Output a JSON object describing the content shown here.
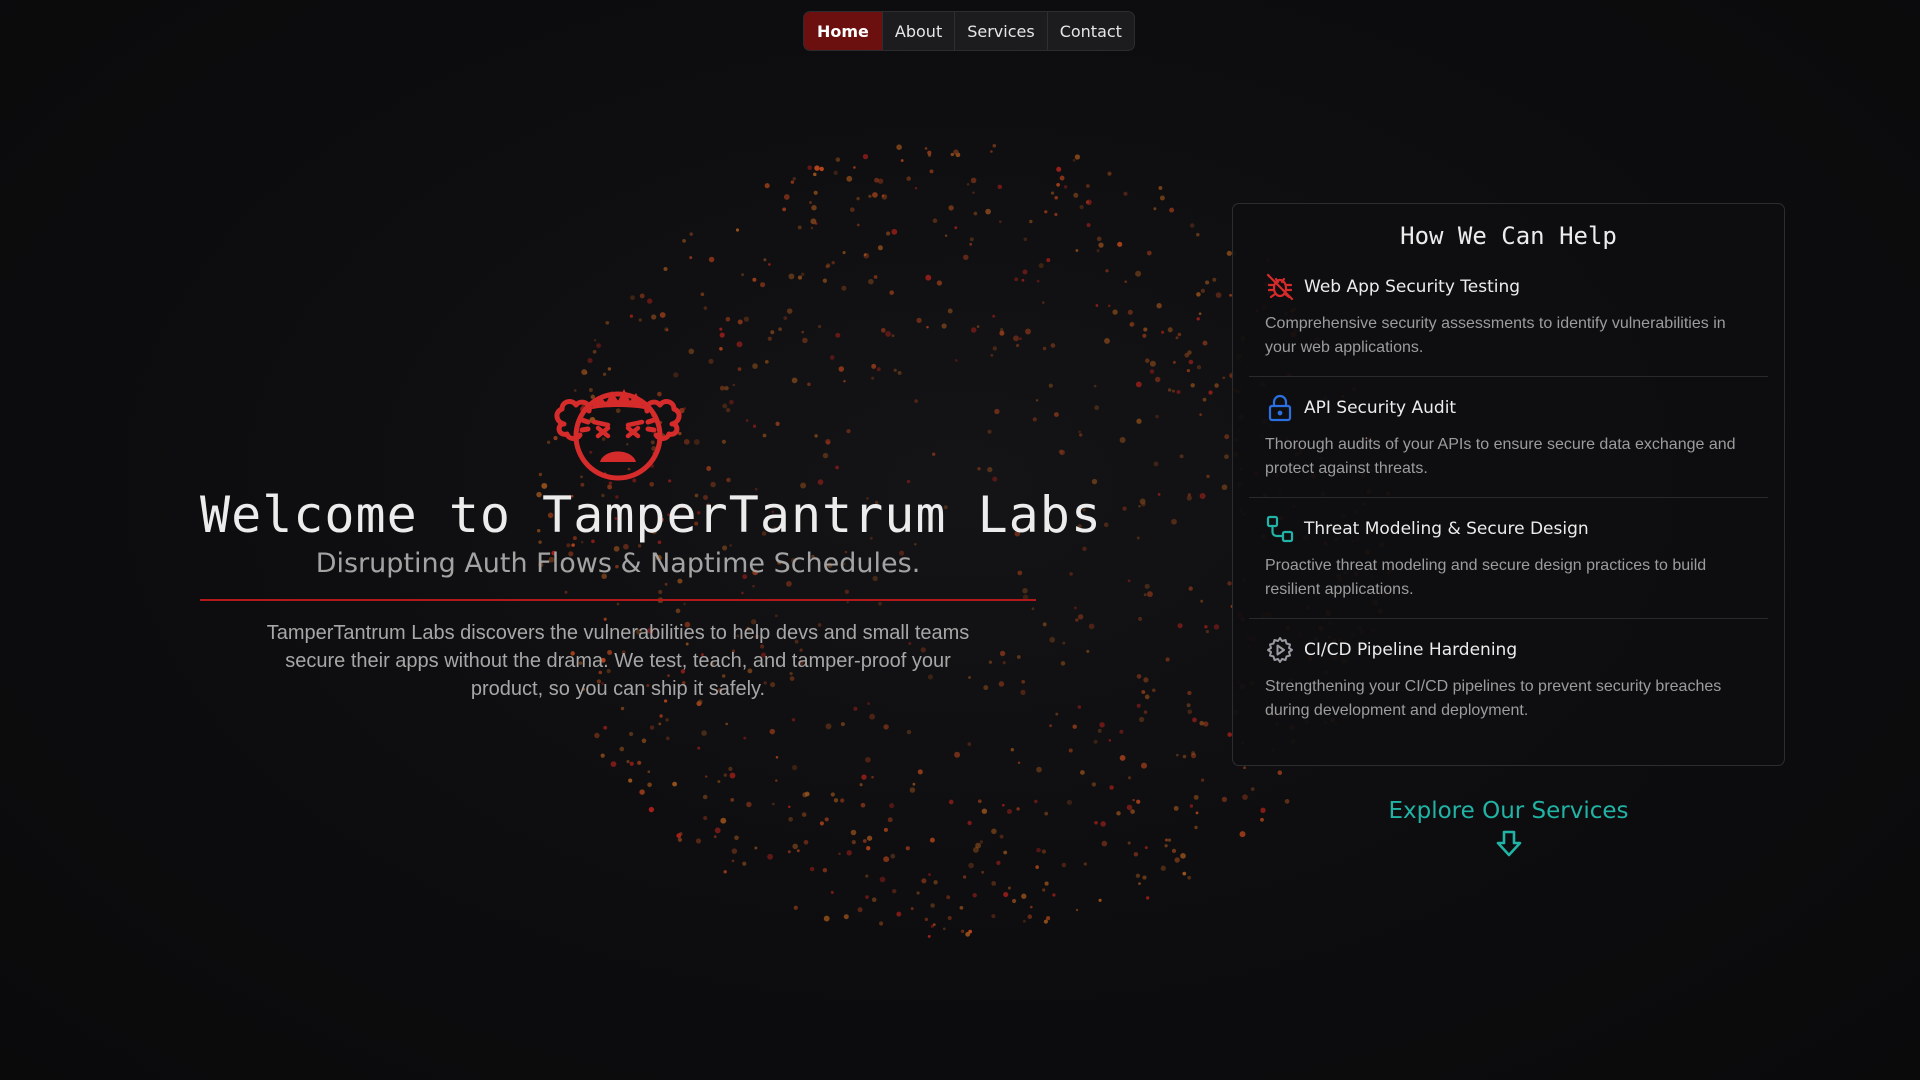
{
  "nav": {
    "items": [
      {
        "label": "Home",
        "active": true
      },
      {
        "label": "About",
        "active": false
      },
      {
        "label": "Services",
        "active": false
      },
      {
        "label": "Contact",
        "active": false
      }
    ]
  },
  "hero": {
    "icon": "angry-face-icon",
    "title": "Welcome to TamperTantrum Labs",
    "subtitle": "Disrupting Auth Flows & Naptime Schedules.",
    "description": "TamperTantrum Labs discovers the vulnerabilities to help devs and small teams secure their apps without the drama. We test, teach, and tamper-proof your product, so you can ship it safely."
  },
  "services_card": {
    "title": "How We Can Help",
    "items": [
      {
        "icon": "bug-off-icon",
        "icon_color": "#d62b2b",
        "name": "Web App Security Testing",
        "description": "Comprehensive security assessments to identify vulnerabilities in your web applications."
      },
      {
        "icon": "lock-icon",
        "icon_color": "#2b6fe0",
        "name": "API Security Audit",
        "description": "Thorough audits of your APIs to ensure secure data exchange and protect against threats."
      },
      {
        "icon": "route-icon",
        "icon_color": "#21b3a5",
        "name": "Threat Modeling & Secure Design",
        "description": "Proactive threat modeling and secure design practices to build resilient applications."
      },
      {
        "icon": "gear-play-icon",
        "icon_color": "#9a9aa2",
        "name": "CI/CD Pipeline Hardening",
        "description": "Strengthening your CI/CD pipelines to prevent security breaches during development and deployment."
      }
    ]
  },
  "explore": {
    "label": "Explore Our Services",
    "icon": "arrow-down-icon",
    "color": "#21b3a5"
  },
  "colors": {
    "background": "#0e0e10",
    "accent_red": "#b3191a",
    "nav_active": "#6b0f0f",
    "teal": "#21b3a5"
  }
}
